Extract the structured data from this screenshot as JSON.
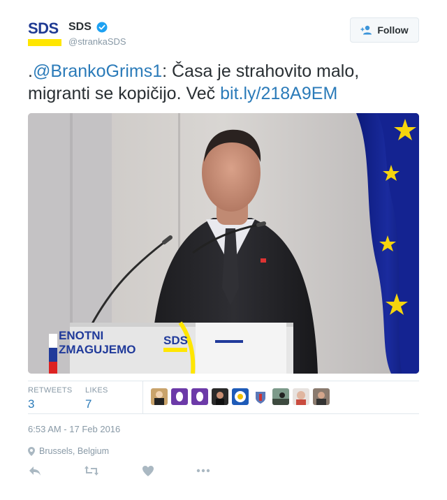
{
  "account": {
    "logo_text": "SDS",
    "display_name": "SDS",
    "handle": "@strankaSDS",
    "verified": true
  },
  "follow_button": {
    "label": "Follow"
  },
  "tweet": {
    "prefix": ".",
    "mention": "@BrankoGrims1",
    "text": ": Časa je strahovito malo, migranti se kopičijo. Več ",
    "link": "bit.ly/218A9EM"
  },
  "photo": {
    "podium_text_line1": "ENOTNI",
    "podium_text_line2": "ZMAGUJEMO",
    "podium_logo": "SDS"
  },
  "stats": {
    "retweets_label": "RETWEETS",
    "retweets_value": "3",
    "likes_label": "LIKES",
    "likes_value": "7",
    "liker_avatars": [
      "avatar-1",
      "avatar-2",
      "avatar-3",
      "avatar-4",
      "avatar-5",
      "avatar-6",
      "avatar-7",
      "avatar-8",
      "avatar-9"
    ]
  },
  "timestamp": "6:53 AM - 17 Feb 2016",
  "location": "Brussels, Belgium",
  "actions": [
    "reply-icon",
    "retweet-icon",
    "like-icon",
    "more-icon"
  ],
  "colors": {
    "link": "#2b7bb9",
    "muted": "#8899a6",
    "logo_blue": "#1f3a93",
    "logo_yellow": "#ffe600"
  }
}
